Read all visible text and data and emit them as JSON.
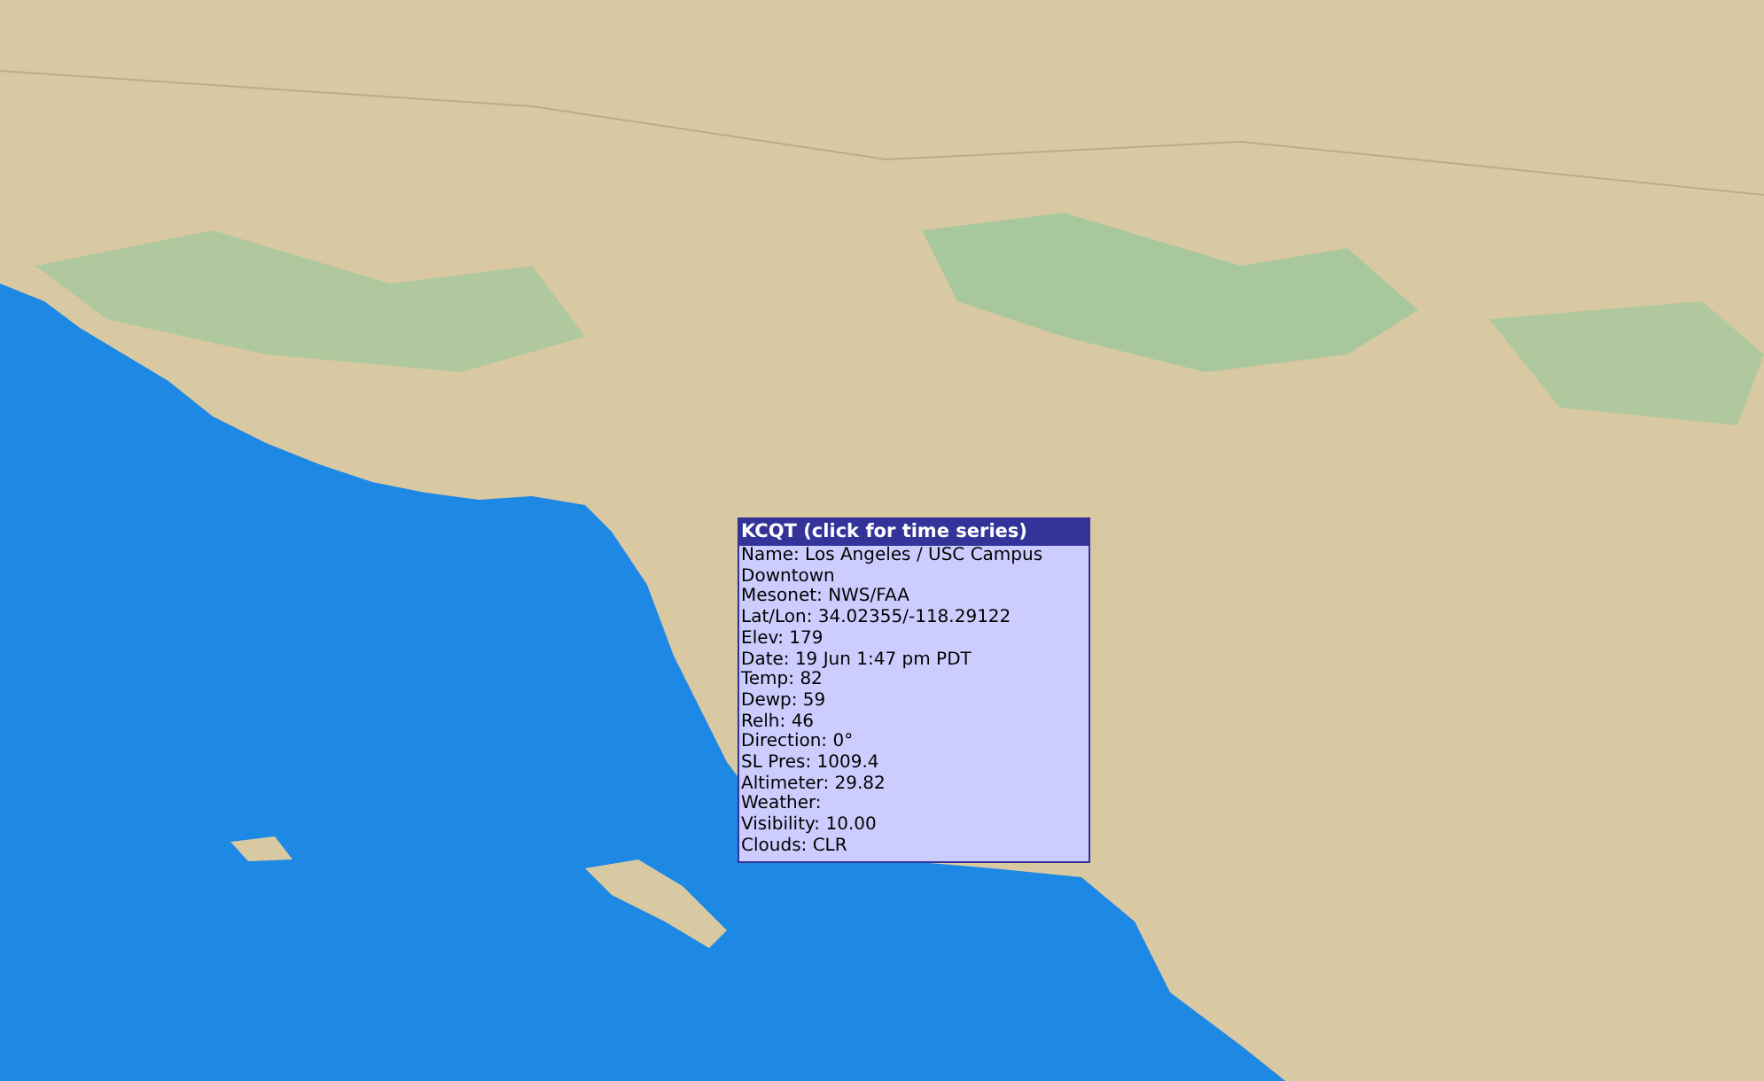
{
  "popup": {
    "title": "KCQT (click for time series)",
    "lines": [
      "Name: Los Angeles / USC Campus",
      "Downtown",
      "Mesonet: NWS/FAA",
      "Lat/Lon: 34.02355/-118.29122",
      "Elev: 179",
      "Date: 19 Jun 1:47 pm PDT",
      "Temp: 82",
      "Dewp: 59",
      "Relh: 46",
      "Direction: 0°",
      "SL Pres: 1009.4",
      "Altimeter: 29.82",
      "Weather:",
      "Visibility: 10.00",
      "Clouds: CLR"
    ]
  }
}
